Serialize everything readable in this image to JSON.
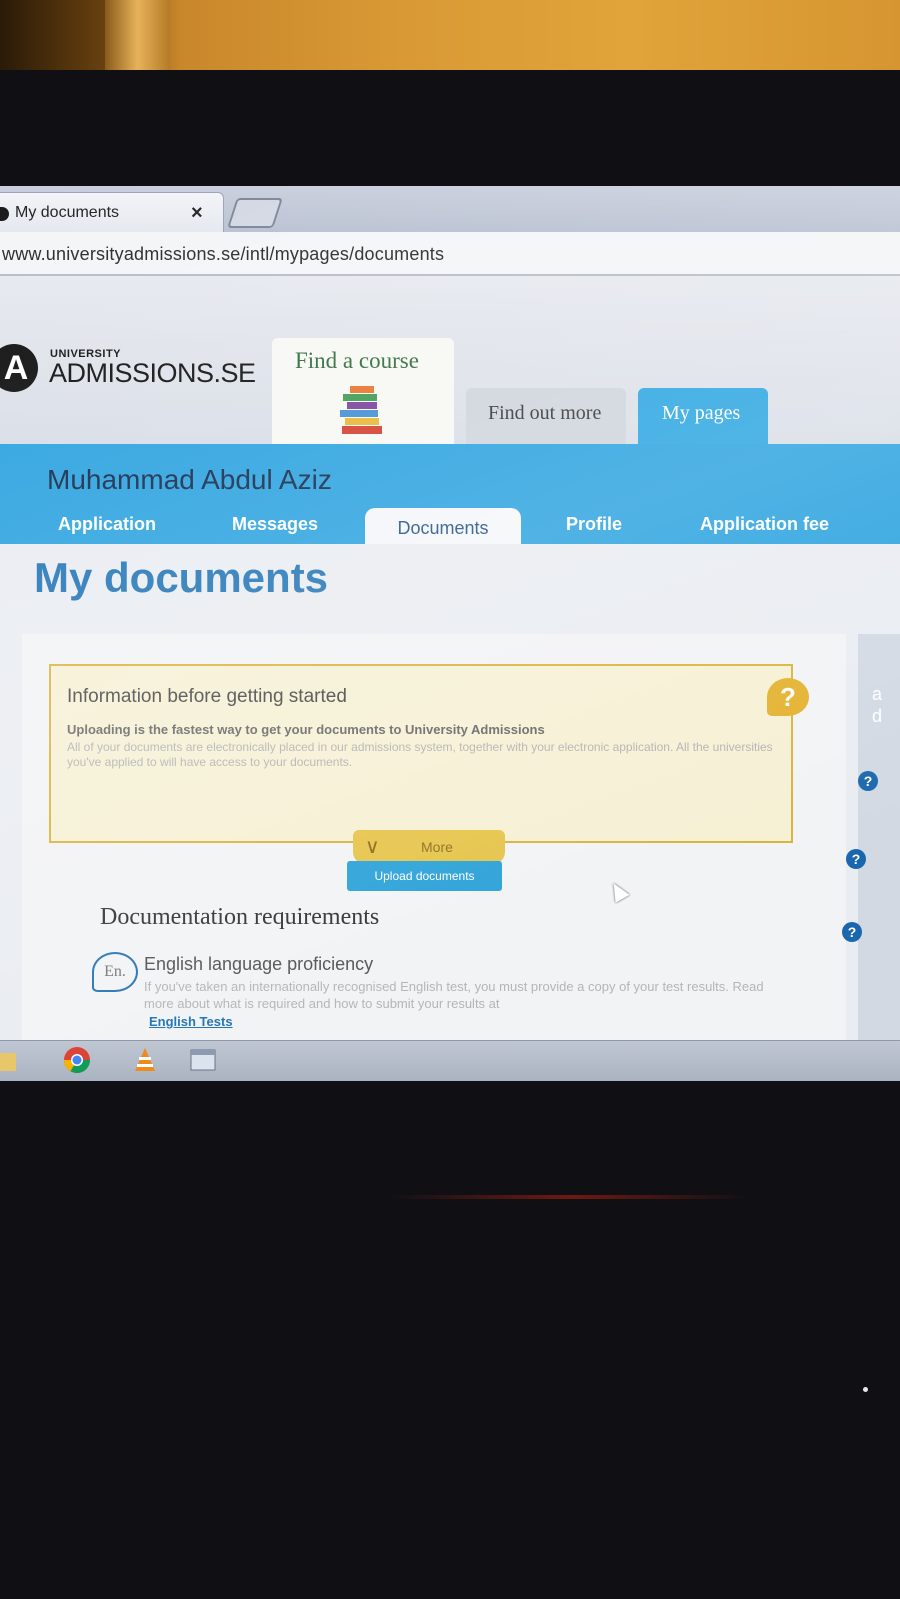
{
  "browser": {
    "tab_title": "My documents",
    "tab_close": "×",
    "url": "www.universityadmissions.se/intl/mypages/documents"
  },
  "site": {
    "logo_letter": "A",
    "logo_small": "UNIVERSITY",
    "logo_big": "ADMISSIONS.SE",
    "tabs": [
      {
        "label": "Find a course"
      },
      {
        "label": "Find out more"
      },
      {
        "label": "My pages"
      }
    ]
  },
  "user": {
    "name": "Muhammad Abdul Aziz"
  },
  "nav": [
    {
      "label": "Application"
    },
    {
      "label": "Messages"
    },
    {
      "label": "Documents"
    },
    {
      "label": "Profile"
    },
    {
      "label": "Application fee"
    }
  ],
  "page": {
    "title": "My documents"
  },
  "info_box": {
    "title": "Information before getting started",
    "help_icon": "?",
    "lead": "Uploading is the fastest way to get your documents to University Admissions",
    "text": "All of your documents are electronically placed in our admissions system, together with your electronic application. All the universities you've applied to will have access to your documents.",
    "more_label": "More"
  },
  "upload_button": "Upload documents",
  "doc_requirements": {
    "heading": "Documentation requirements",
    "items": [
      {
        "icon_label": "En.",
        "title": "English language proficiency",
        "text": "If you've taken an internationally recognised English test, you must provide a copy of your test results. Read more about what is required and how to submit your results at",
        "link": "English Tests"
      }
    ]
  },
  "sidebar": {
    "fragments": [
      "a",
      "d"
    ],
    "help_icon": "?"
  },
  "colors": {
    "brand_blue": "#2aa2df",
    "info_yellow": "#d8b43c",
    "title_blue": "#1f73b5"
  }
}
